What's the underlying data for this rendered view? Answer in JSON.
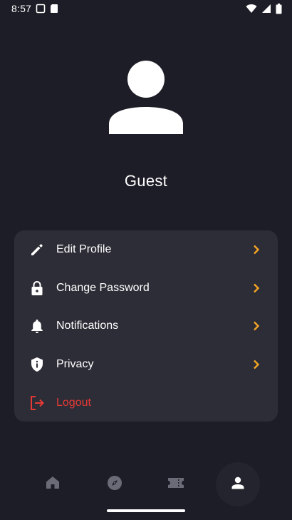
{
  "status_bar": {
    "time": "8:57"
  },
  "profile": {
    "name": "Guest"
  },
  "menu": {
    "items": [
      {
        "label": "Edit Profile",
        "icon": "pencil-icon"
      },
      {
        "label": "Change Password",
        "icon": "lock-icon"
      },
      {
        "label": "Notifications",
        "icon": "bell-icon"
      },
      {
        "label": "Privacy",
        "icon": "shield-icon"
      },
      {
        "label": "Logout",
        "icon": "logout-icon"
      }
    ]
  },
  "bottom_nav": {
    "items": [
      {
        "icon": "home-icon",
        "active": false
      },
      {
        "icon": "compass-icon",
        "active": false
      },
      {
        "icon": "ticket-icon",
        "active": false
      },
      {
        "icon": "person-icon",
        "active": true
      }
    ]
  },
  "colors": {
    "background": "#1d1d27",
    "card": "#2d2d37",
    "accent_chevron": "#f5a524",
    "logout": "#e53935",
    "nav_inactive": "#6b6b78"
  }
}
